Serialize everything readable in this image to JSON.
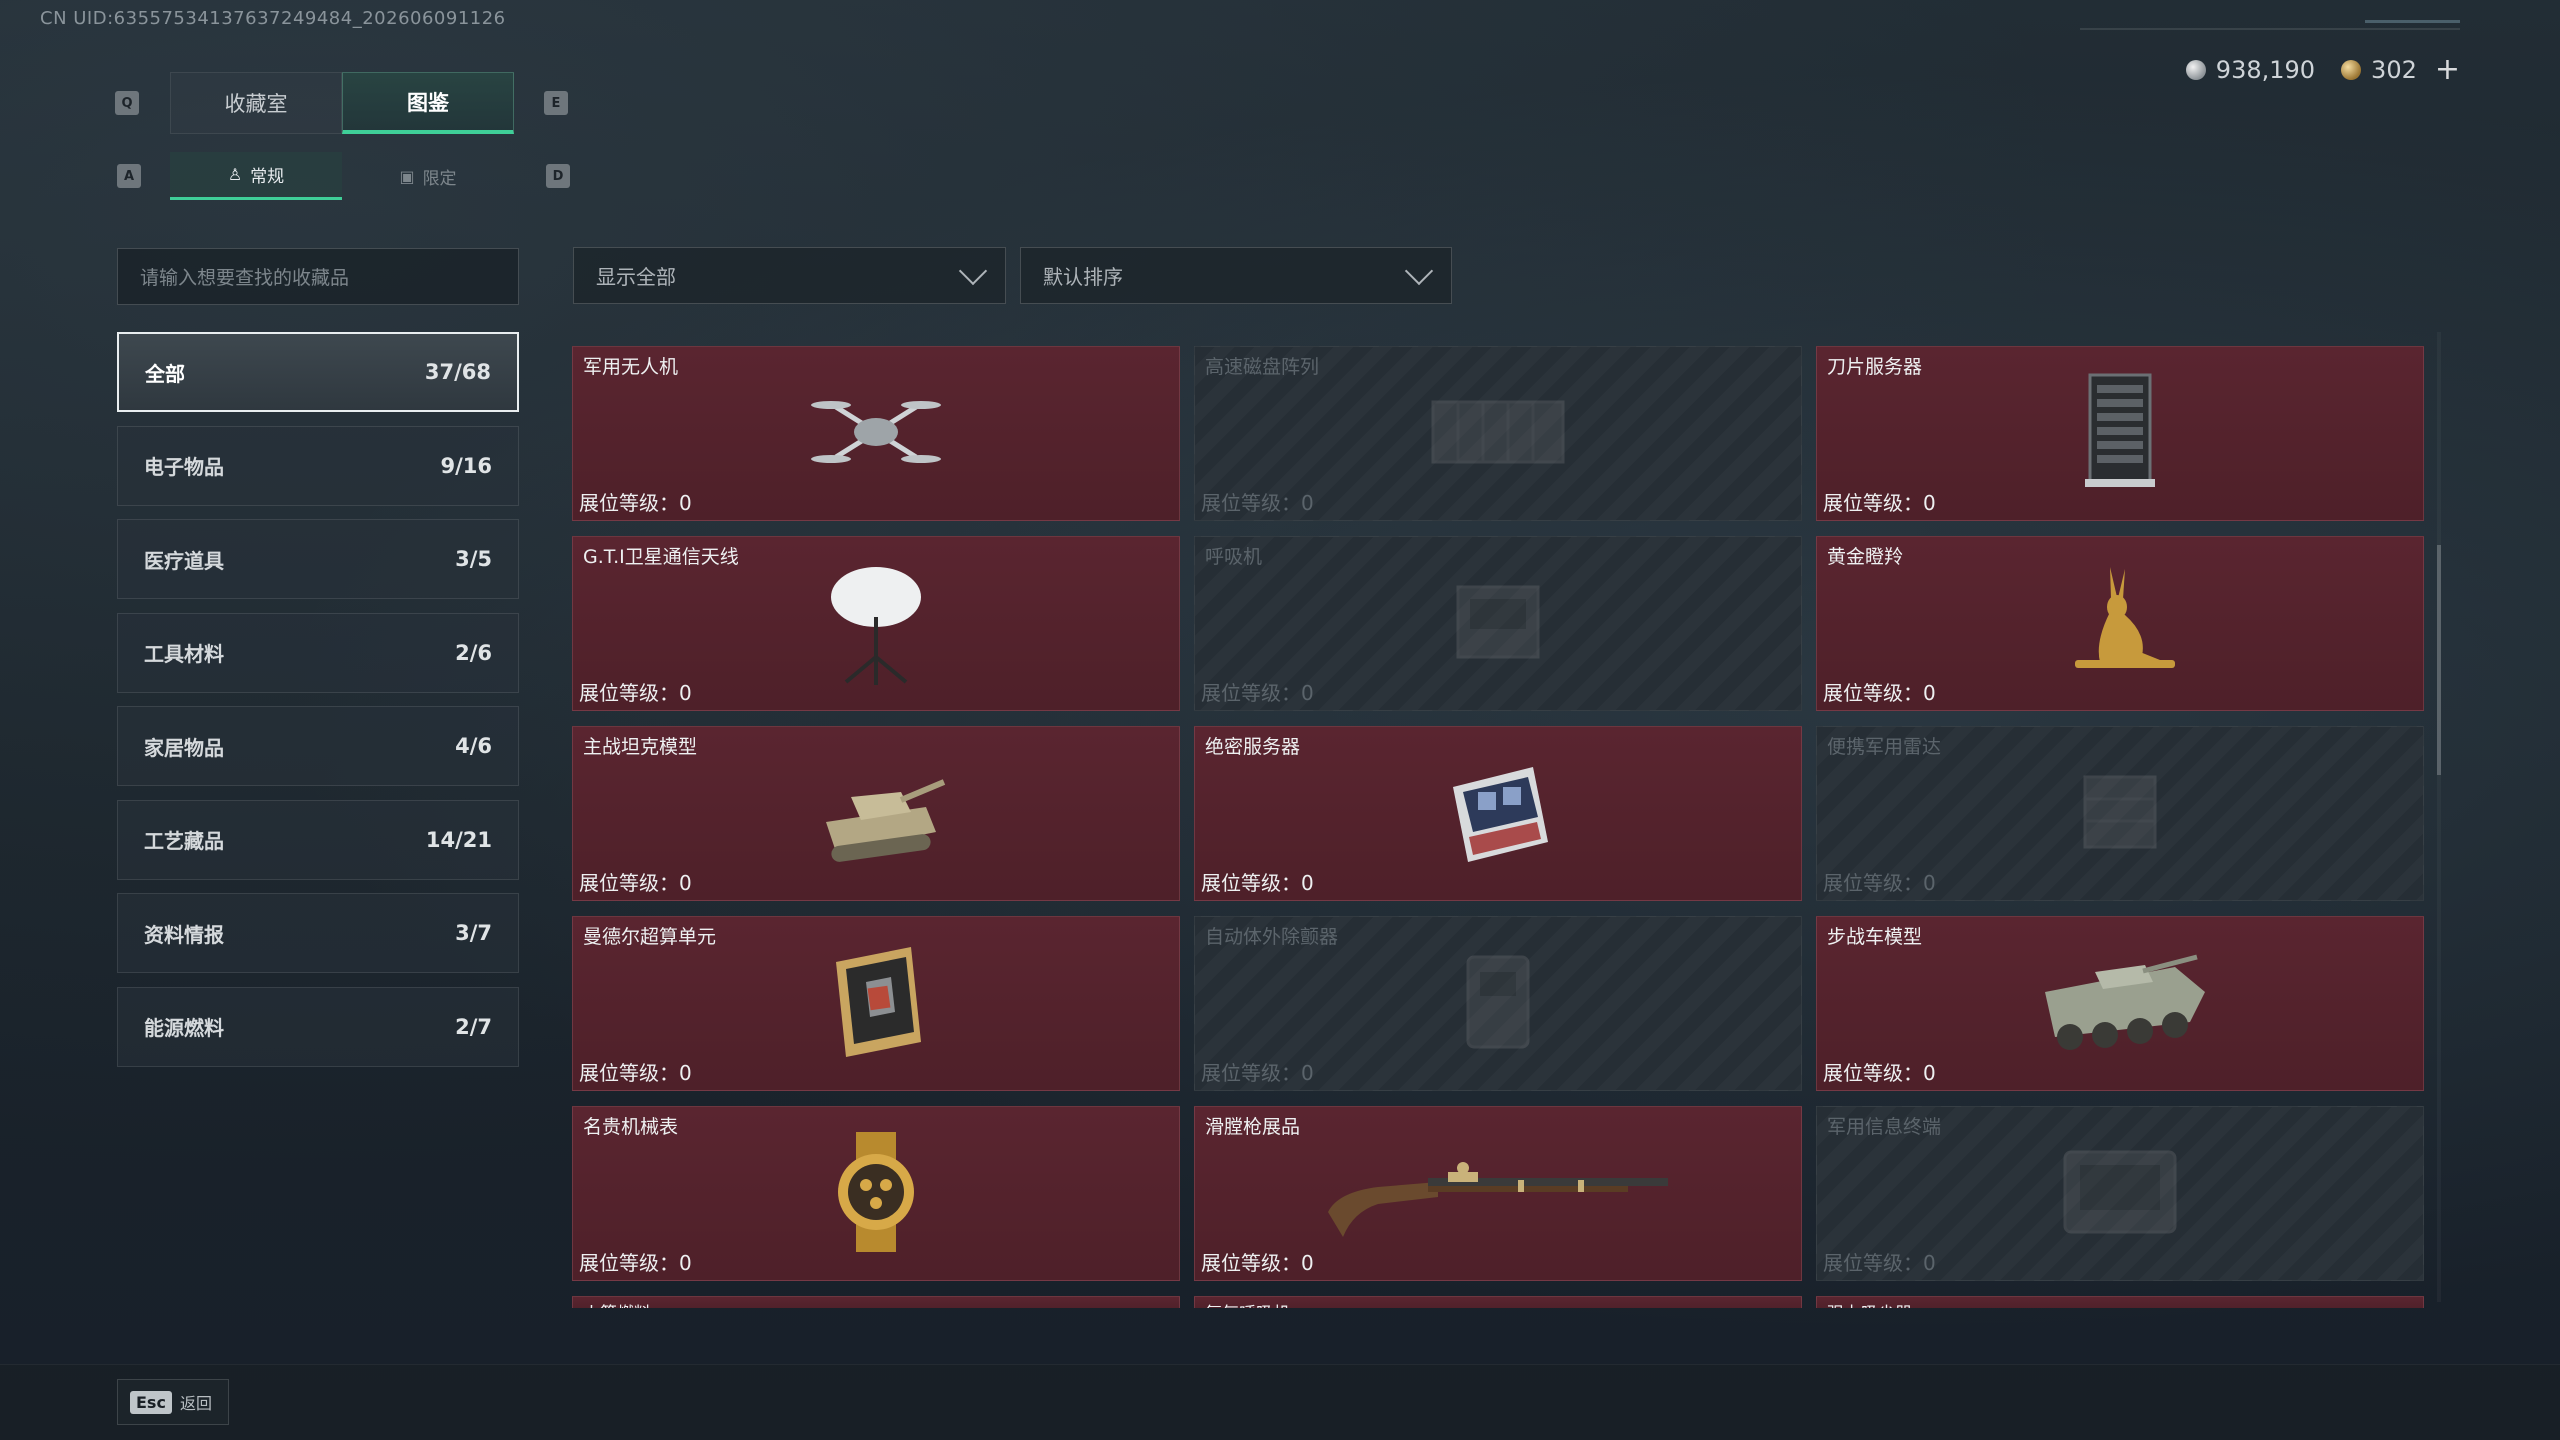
{
  "uid": "CN UID:6355753413763724948​4_202606091126",
  "currency": {
    "silver": "938,190",
    "gold": "302",
    "plus": "+"
  },
  "keys": {
    "q": "Q",
    "e": "E",
    "a": "A",
    "d": "D"
  },
  "main_tabs": [
    {
      "label": "收藏室"
    },
    {
      "label": "图鉴"
    }
  ],
  "sub_tabs": [
    {
      "label": "常规"
    },
    {
      "label": "限定"
    }
  ],
  "search": {
    "placeholder": "请输入想要查找的收藏品"
  },
  "filter": {
    "value": "显示全部"
  },
  "sort": {
    "value": "默认排序"
  },
  "categories": [
    {
      "label": "全部",
      "count": "37/68"
    },
    {
      "label": "电子物品",
      "count": "9/16"
    },
    {
      "label": "医疗道具",
      "count": "3/5"
    },
    {
      "label": "工具材料",
      "count": "2/6"
    },
    {
      "label": "家居物品",
      "count": "4/6"
    },
    {
      "label": "工艺藏品",
      "count": "14/21"
    },
    {
      "label": "资料情报",
      "count": "3/7"
    },
    {
      "label": "能源燃料",
      "count": "2/7"
    }
  ],
  "items": [
    {
      "name": "军用无人机",
      "level": "展位等级：0",
      "owned": true,
      "icon": "drone-icon"
    },
    {
      "name": "高速磁盘阵列",
      "level": "展位等级：0",
      "owned": false,
      "icon": "disk-array-icon"
    },
    {
      "name": "刀片服务器",
      "level": "展位等级：0",
      "owned": true,
      "icon": "blade-server-icon"
    },
    {
      "name": "G.T.I卫星通信天线",
      "level": "展位等级：0",
      "owned": true,
      "icon": "satellite-dish-icon"
    },
    {
      "name": "呼吸机",
      "level": "展位等级：0",
      "owned": false,
      "icon": "ventilator-icon"
    },
    {
      "name": "黄金瞪羚",
      "level": "展位等级：0",
      "owned": true,
      "icon": "gold-gazelle-icon"
    },
    {
      "name": "主战坦克模型",
      "level": "展位等级：0",
      "owned": true,
      "icon": "tank-model-icon"
    },
    {
      "name": "绝密服务器",
      "level": "展位等级：0",
      "owned": true,
      "icon": "secret-server-icon"
    },
    {
      "name": "便携军用雷达",
      "level": "展位等级：0",
      "owned": false,
      "icon": "radar-icon"
    },
    {
      "name": "曼德尔超算单元",
      "level": "展位等级：0",
      "owned": true,
      "icon": "supercomputer-unit-icon"
    },
    {
      "name": "自动体外除颤器",
      "level": "展位等级：0",
      "owned": false,
      "icon": "defibrillator-icon"
    },
    {
      "name": "步战车模型",
      "level": "展位等级：0",
      "owned": true,
      "icon": "ifv-model-icon"
    },
    {
      "name": "名贵机械表",
      "level": "展位等级：0",
      "owned": true,
      "icon": "watch-icon"
    },
    {
      "name": "滑膛枪展品",
      "level": "展位等级：0",
      "owned": true,
      "icon": "musket-icon"
    },
    {
      "name": "军用信息终端",
      "level": "展位等级：0",
      "owned": false,
      "icon": "military-terminal-icon"
    }
  ],
  "partial_row": [
    {
      "name": "火箭燃料"
    },
    {
      "name": "氧气呼吸机"
    },
    {
      "name": "强力吸尘器"
    }
  ],
  "back": {
    "key": "Esc",
    "label": "返回"
  },
  "colors": {
    "accent": "#3fcf98",
    "owned_card": "#5a2530",
    "locked_card": "#262e35"
  }
}
